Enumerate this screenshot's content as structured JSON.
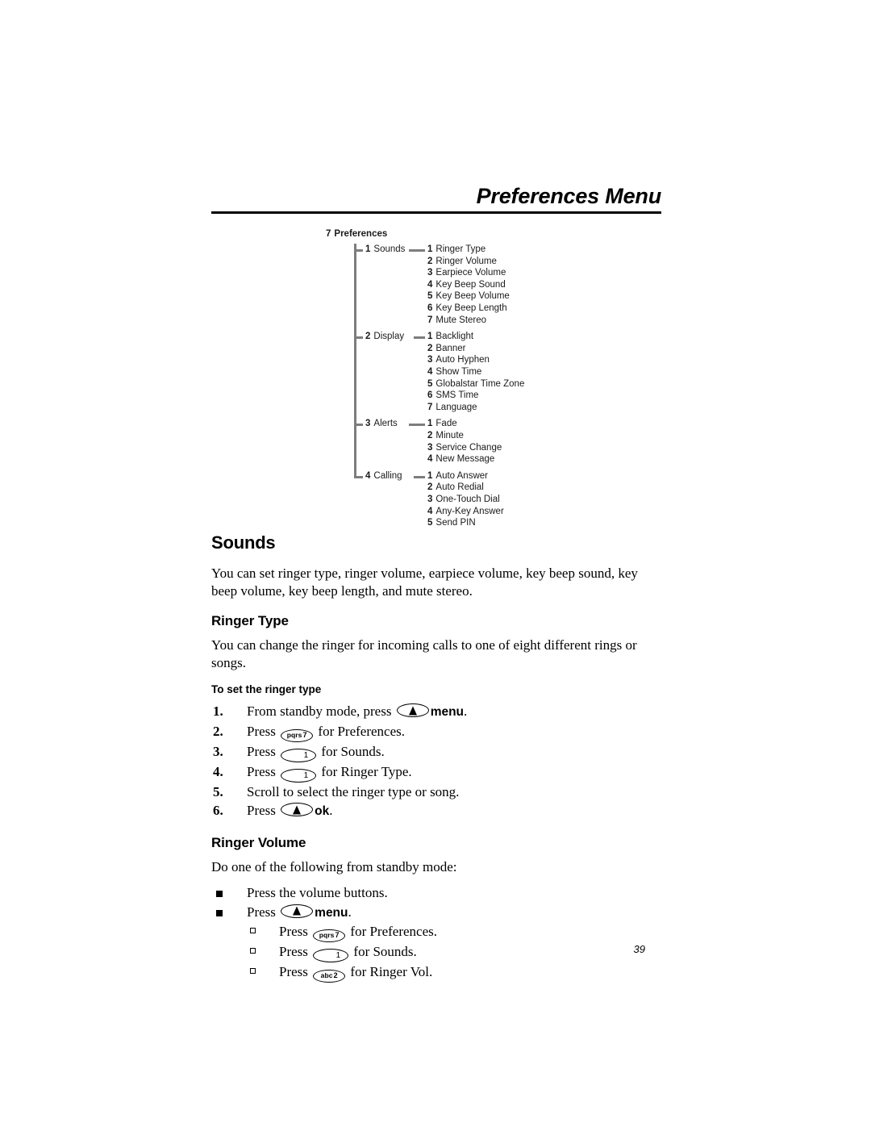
{
  "header": {
    "title": "Preferences Menu"
  },
  "tree": {
    "root": {
      "num": "7",
      "label": "Preferences"
    },
    "branches": [
      {
        "num": "1",
        "label": "Sounds",
        "children": [
          {
            "num": "1",
            "label": "Ringer Type"
          },
          {
            "num": "2",
            "label": "Ringer Volume"
          },
          {
            "num": "3",
            "label": "Earpiece Volume"
          },
          {
            "num": "4",
            "label": "Key Beep Sound"
          },
          {
            "num": "5",
            "label": "Key Beep Volume"
          },
          {
            "num": "6",
            "label": "Key Beep Length"
          },
          {
            "num": "7",
            "label": "Mute Stereo"
          }
        ]
      },
      {
        "num": "2",
        "label": "Display",
        "children": [
          {
            "num": "1",
            "label": "Backlight"
          },
          {
            "num": "2",
            "label": "Banner"
          },
          {
            "num": "3",
            "label": "Auto Hyphen"
          },
          {
            "num": "4",
            "label": "Show Time"
          },
          {
            "num": "5",
            "label": "Globalstar Time Zone"
          },
          {
            "num": "6",
            "label": "SMS Time"
          },
          {
            "num": "7",
            "label": "Language"
          }
        ]
      },
      {
        "num": "3",
        "label": "Alerts",
        "children": [
          {
            "num": "1",
            "label": "Fade"
          },
          {
            "num": "2",
            "label": "Minute"
          },
          {
            "num": "3",
            "label": "Service Change"
          },
          {
            "num": "4",
            "label": "New Message"
          }
        ]
      },
      {
        "num": "4",
        "label": "Calling",
        "children": [
          {
            "num": "1",
            "label": "Auto Answer"
          },
          {
            "num": "2",
            "label": "Auto Redial"
          },
          {
            "num": "3",
            "label": "One-Touch Dial"
          },
          {
            "num": "4",
            "label": "Any-Key Answer"
          },
          {
            "num": "5",
            "label": "Send PIN"
          }
        ]
      }
    ]
  },
  "sounds": {
    "heading": "Sounds",
    "intro": "You can set ringer type, ringer volume, earpiece volume, key beep sound, key beep volume, key beep length, and mute stereo."
  },
  "ringer_type": {
    "heading": "Ringer Type",
    "intro": "You can change the ringer for incoming calls to one of eight different rings or songs.",
    "procedure_heading": "To set the ringer type",
    "steps": [
      {
        "marker": "1.",
        "before": "From standby mode, press ",
        "key": {
          "type": "nav",
          "icon": "up-triangle"
        },
        "bold": "menu",
        "after": "."
      },
      {
        "marker": "2.",
        "before": "Press ",
        "key": {
          "type": "letters",
          "letters": "pqrs",
          "number": "7"
        },
        "after": " for Preferences."
      },
      {
        "marker": "3.",
        "before": "Press ",
        "key": {
          "type": "number",
          "number": "1"
        },
        "after": " for Sounds."
      },
      {
        "marker": "4.",
        "before": "Press ",
        "key": {
          "type": "number",
          "number": "1"
        },
        "after": " for Ringer Type."
      },
      {
        "marker": "5.",
        "before": "Scroll to select the ringer type or song.",
        "after": ""
      },
      {
        "marker": "6.",
        "before": "Press ",
        "key": {
          "type": "nav",
          "icon": "up-triangle"
        },
        "bold": "ok",
        "after": "."
      }
    ]
  },
  "ringer_volume": {
    "heading": "Ringer Volume",
    "intro": "Do one of the following from standby mode:",
    "bullets": [
      {
        "before": "Press the volume buttons.",
        "after": ""
      },
      {
        "before": "Press ",
        "key": {
          "type": "nav",
          "icon": "up-triangle"
        },
        "bold": "menu",
        "after": "."
      }
    ],
    "subbullets": [
      {
        "before": "Press ",
        "key": {
          "type": "letters",
          "letters": "pqrs",
          "number": "7"
        },
        "after": " for Preferences."
      },
      {
        "before": "Press ",
        "key": {
          "type": "number",
          "number": "1"
        },
        "after": " for Sounds."
      },
      {
        "before": "Press ",
        "key": {
          "type": "letters",
          "letters": "abc",
          "number": "2"
        },
        "after": " for Ringer Vol."
      }
    ]
  },
  "footer": {
    "page_number": "39"
  }
}
